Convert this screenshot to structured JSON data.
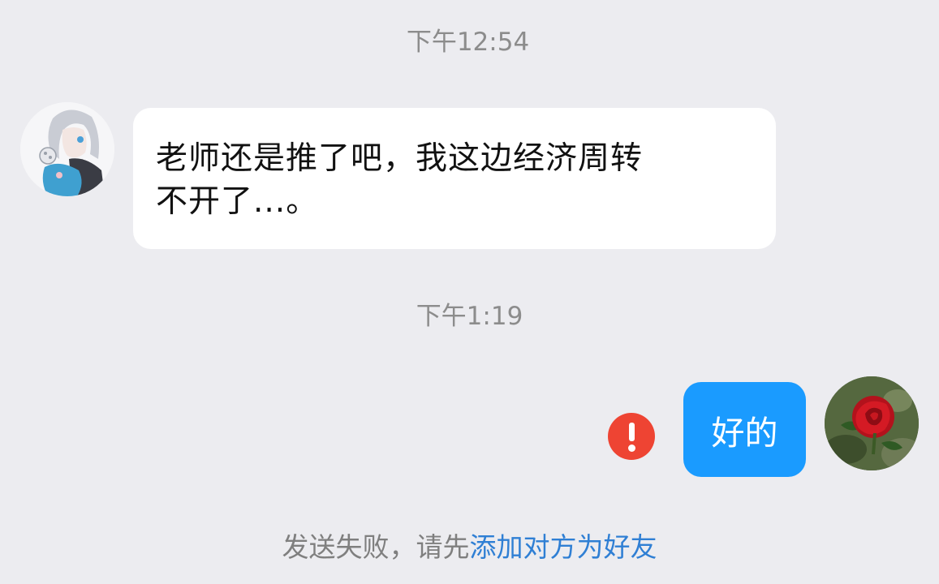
{
  "messages": {
    "timestamp_1": "下午12:54",
    "incoming": {
      "line_1": "老师还是推了吧，我这边经济周转",
      "line_2": "不开了...。"
    },
    "timestamp_2": "下午1:19",
    "outgoing": {
      "text": "好的",
      "status_icon": "error-exclamation-icon"
    }
  },
  "notice": {
    "prefix": "发送失败，请先",
    "link_text": "添加对方为好友"
  },
  "colors": {
    "background": "#ececf0",
    "incoming_bubble": "#ffffff",
    "outgoing_bubble": "#1a9bff",
    "error": "#ee4433",
    "link": "#2f7fd4"
  }
}
